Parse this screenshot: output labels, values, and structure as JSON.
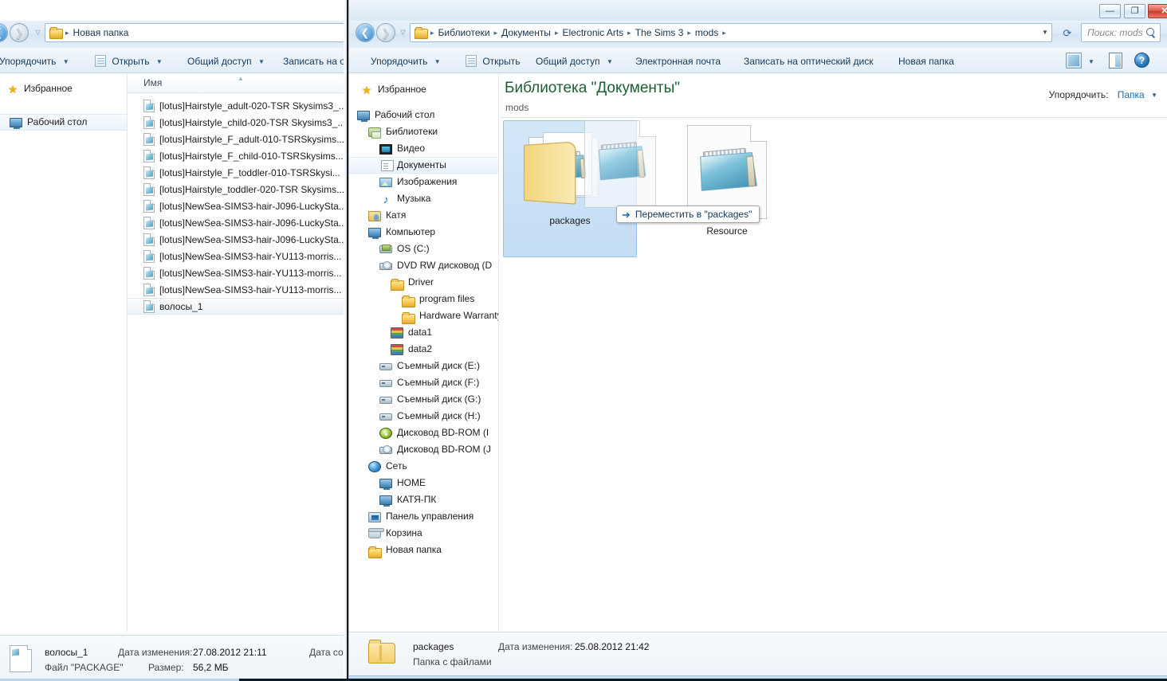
{
  "left_window": {
    "address": {
      "path_label": "Новая папка"
    },
    "toolbar": {
      "organize": "Упорядочить",
      "open": "Открыть",
      "share": "Общий доступ",
      "burn": "Записать на о"
    },
    "nav": {
      "favorites": "Избранное",
      "desktop": "Рабочий стол"
    },
    "list": {
      "column_name": "Имя",
      "files": [
        "[lotus]Hairstyle_adult-020-TSR Skysims3_...",
        "[lotus]Hairstyle_child-020-TSR Skysims3_...",
        "[lotus]Hairstyle_F_adult-010-TSRSkysims...",
        "[lotus]Hairstyle_F_child-010-TSRSkysims...",
        "[lotus]Hairstyle_F_toddler-010-TSRSkysi...",
        "[lotus]Hairstyle_toddler-020-TSR Skysims...",
        "[lotus]NewSea-SIMS3-hair-J096-LuckySta...",
        "[lotus]NewSea-SIMS3-hair-J096-LuckySta...",
        "[lotus]NewSea-SIMS3-hair-J096-LuckySta...",
        "[lotus]NewSea-SIMS3-hair-YU113-morris...",
        "[lotus]NewSea-SIMS3-hair-YU113-morris...",
        "[lotus]NewSea-SIMS3-hair-YU113-morris...",
        "волосы_1"
      ],
      "selected_index": 12
    },
    "details": {
      "name": "волосы_1",
      "type": "Файл \"PACKAGE\"",
      "modified_key": "Дата изменения:",
      "modified_val": "27.08.2012 21:11",
      "size_key": "Размер:",
      "size_val": "56,2 МБ",
      "created_key": "Дата со"
    }
  },
  "right_window": {
    "titlebar": {
      "minimize": "—",
      "maximize": "❐",
      "close": "✕"
    },
    "address": {
      "crumbs": [
        "Библиотеки",
        "Документы",
        "Electronic Arts",
        "The Sims 3",
        "mods"
      ],
      "separator": "▸"
    },
    "search": {
      "placeholder": "Поиск: mods"
    },
    "toolbar": {
      "organize": "Упорядочить",
      "open": "Открыть",
      "share": "Общий доступ",
      "email": "Электронная почта",
      "burn": "Записать на оптический диск",
      "new_folder": "Новая папка",
      "help_glyph": "?"
    },
    "nav": {
      "favorites": "Избранное",
      "items": [
        {
          "label": "Рабочий стол",
          "icon": "monitor-icon",
          "indent": 0,
          "selected": false
        },
        {
          "label": "Библиотеки",
          "icon": "library-icon",
          "indent": 1,
          "selected": false
        },
        {
          "label": "Видео",
          "icon": "video-icon",
          "indent": 2,
          "selected": false
        },
        {
          "label": "Документы",
          "icon": "document-icon",
          "indent": 2,
          "selected": true
        },
        {
          "label": "Изображения",
          "icon": "picture-icon",
          "indent": 2,
          "selected": false
        },
        {
          "label": "Музыка",
          "icon": "music-icon",
          "indent": 2,
          "selected": false
        },
        {
          "label": "Катя",
          "icon": "user-icon",
          "indent": 1,
          "selected": false
        },
        {
          "label": "Компьютер",
          "icon": "computer-icon",
          "indent": 1,
          "selected": false
        },
        {
          "label": "OS (C:)",
          "icon": "os-drive-icon",
          "indent": 2,
          "selected": false
        },
        {
          "label": "DVD RW дисковод (D",
          "icon": "dvd-drive-icon",
          "indent": 2,
          "selected": false
        },
        {
          "label": "Driver",
          "icon": "folder-icon",
          "indent": 3,
          "selected": false
        },
        {
          "label": "program files",
          "icon": "folder-icon",
          "indent": 4,
          "selected": false
        },
        {
          "label": "Hardware Warranty",
          "icon": "folder-icon",
          "indent": 4,
          "selected": false
        },
        {
          "label": "data1",
          "icon": "books-icon",
          "indent": 3,
          "selected": false
        },
        {
          "label": "data2",
          "icon": "books-icon",
          "indent": 3,
          "selected": false
        },
        {
          "label": "Съемный диск (E:)",
          "icon": "removable-icon",
          "indent": 2,
          "selected": false
        },
        {
          "label": "Съемный диск (F:)",
          "icon": "removable-icon",
          "indent": 2,
          "selected": false
        },
        {
          "label": "Съемный диск (G:)",
          "icon": "removable-icon",
          "indent": 2,
          "selected": false
        },
        {
          "label": "Съемный диск (H:)",
          "icon": "removable-icon",
          "indent": 2,
          "selected": false
        },
        {
          "label": "Дисковод BD-ROM (I",
          "icon": "bd-rom-icon",
          "indent": 2,
          "selected": false
        },
        {
          "label": "Дисковод BD-ROM (J",
          "icon": "dvd-drive-icon",
          "indent": 2,
          "selected": false
        },
        {
          "label": "Сеть",
          "icon": "network-icon",
          "indent": 1,
          "selected": false
        },
        {
          "label": "HOME",
          "icon": "computer-icon",
          "indent": 2,
          "selected": false
        },
        {
          "label": "КАТЯ-ПК",
          "icon": "computer-icon",
          "indent": 2,
          "selected": false
        },
        {
          "label": "Панель управления",
          "icon": "control-panel-icon",
          "indent": 1,
          "selected": false
        },
        {
          "label": "Корзина",
          "icon": "recycle-bin-icon",
          "indent": 1,
          "selected": false
        },
        {
          "label": "Новая папка",
          "icon": "folder-icon",
          "indent": 1,
          "selected": false
        }
      ]
    },
    "content": {
      "library_title": "Библиотека \"Документы\"",
      "library_subtitle": "mods",
      "arrange_label": "Упорядочить:",
      "arrange_value": "Папка",
      "tiles": [
        {
          "name": "packages",
          "kind": "folder",
          "selected": true
        },
        {
          "name": "Resource",
          "kind": "document",
          "selected": false
        }
      ],
      "drag_tooltip": "Переместить в \"packages\"",
      "drag_arrow": "➜"
    },
    "details": {
      "name": "packages",
      "type": "Папка с файлами",
      "modified_key": "Дата изменения:",
      "modified_val": "25.08.2012 21:42"
    }
  }
}
